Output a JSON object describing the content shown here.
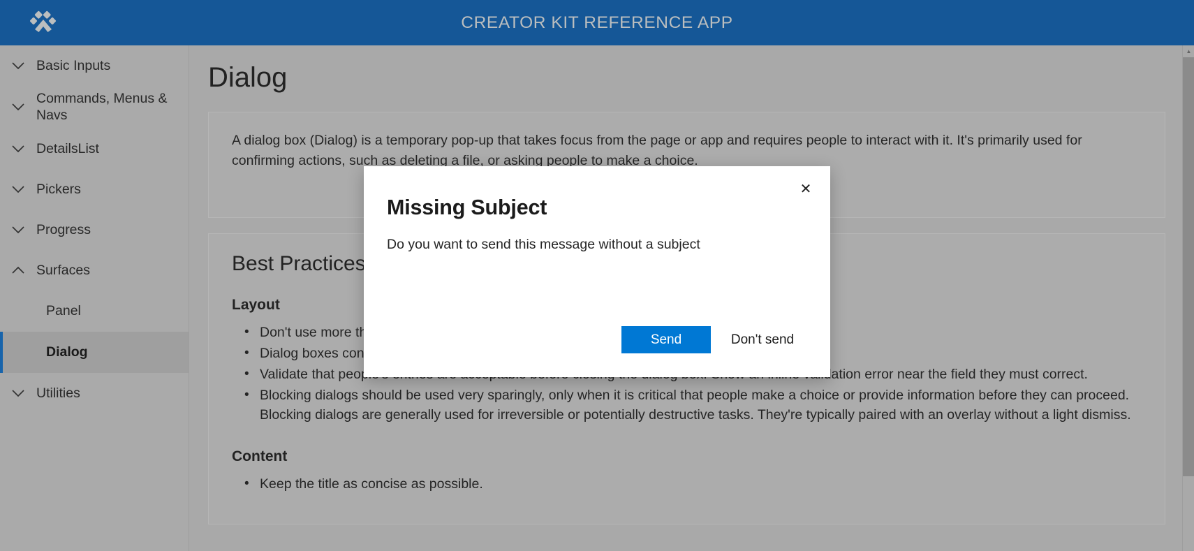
{
  "header": {
    "title": "CREATOR KIT REFERENCE APP",
    "logo_icon": "paw-print-icon",
    "background_color": "#0c5193",
    "title_color": "#b9bcbd"
  },
  "sidebar": {
    "items": [
      {
        "label": "Basic Inputs",
        "icon": "chevron-down-icon",
        "expanded": false
      },
      {
        "label": "Commands, Menus & Navs",
        "icon": "chevron-down-icon",
        "expanded": false
      },
      {
        "label": "DetailsList",
        "icon": "chevron-down-icon",
        "expanded": false
      },
      {
        "label": "Pickers",
        "icon": "chevron-down-icon",
        "expanded": false
      },
      {
        "label": "Progress",
        "icon": "chevron-down-icon",
        "expanded": false
      },
      {
        "label": "Surfaces",
        "icon": "chevron-up-icon",
        "expanded": true
      }
    ],
    "sub_items": [
      {
        "label": "Panel",
        "selected": false
      },
      {
        "label": "Dialog",
        "selected": true
      }
    ],
    "trailing_items": [
      {
        "label": "Utilities",
        "icon": "chevron-down-icon",
        "expanded": false
      }
    ],
    "selected_accent_color": "#0f5ea8"
  },
  "main": {
    "page_title": "Dialog",
    "intro": "A dialog box (Dialog) is a temporary pop-up that takes focus from the page or app and requires people to interact with it. It's primarily used for confirming actions, such as deleting a file, or asking people to make a choice.",
    "best_practices_heading": "Best Practices",
    "layout_heading": "Layout",
    "layout_bullets": [
      "Don't use more than three buttons.",
      "Dialog boxes consist of a header, body, and footer.",
      "Validate that people's entries are acceptable before closing the dialog box. Show an inline validation error near the field they must correct.",
      "Blocking dialogs should be used very sparingly, only when it is critical that people make a choice or provide information before they can proceed. Blocking dialogs are generally used for irreversible or potentially destructive tasks. They're typically paired with an overlay without a light dismiss."
    ],
    "content_heading": "Content",
    "content_bullets": [
      "Keep the title as concise as possible."
    ]
  },
  "dialog": {
    "title": "Missing Subject",
    "subtext": "Do you want to send this message without a subject",
    "close_icon": "close-icon",
    "close_glyph": "✕",
    "primary_button": "Send",
    "secondary_button": "Don't send",
    "primary_color": "#0078d4"
  },
  "scrollbar": {
    "up_arrow_glyph": "▲",
    "down_arrow_glyph": "▼"
  }
}
